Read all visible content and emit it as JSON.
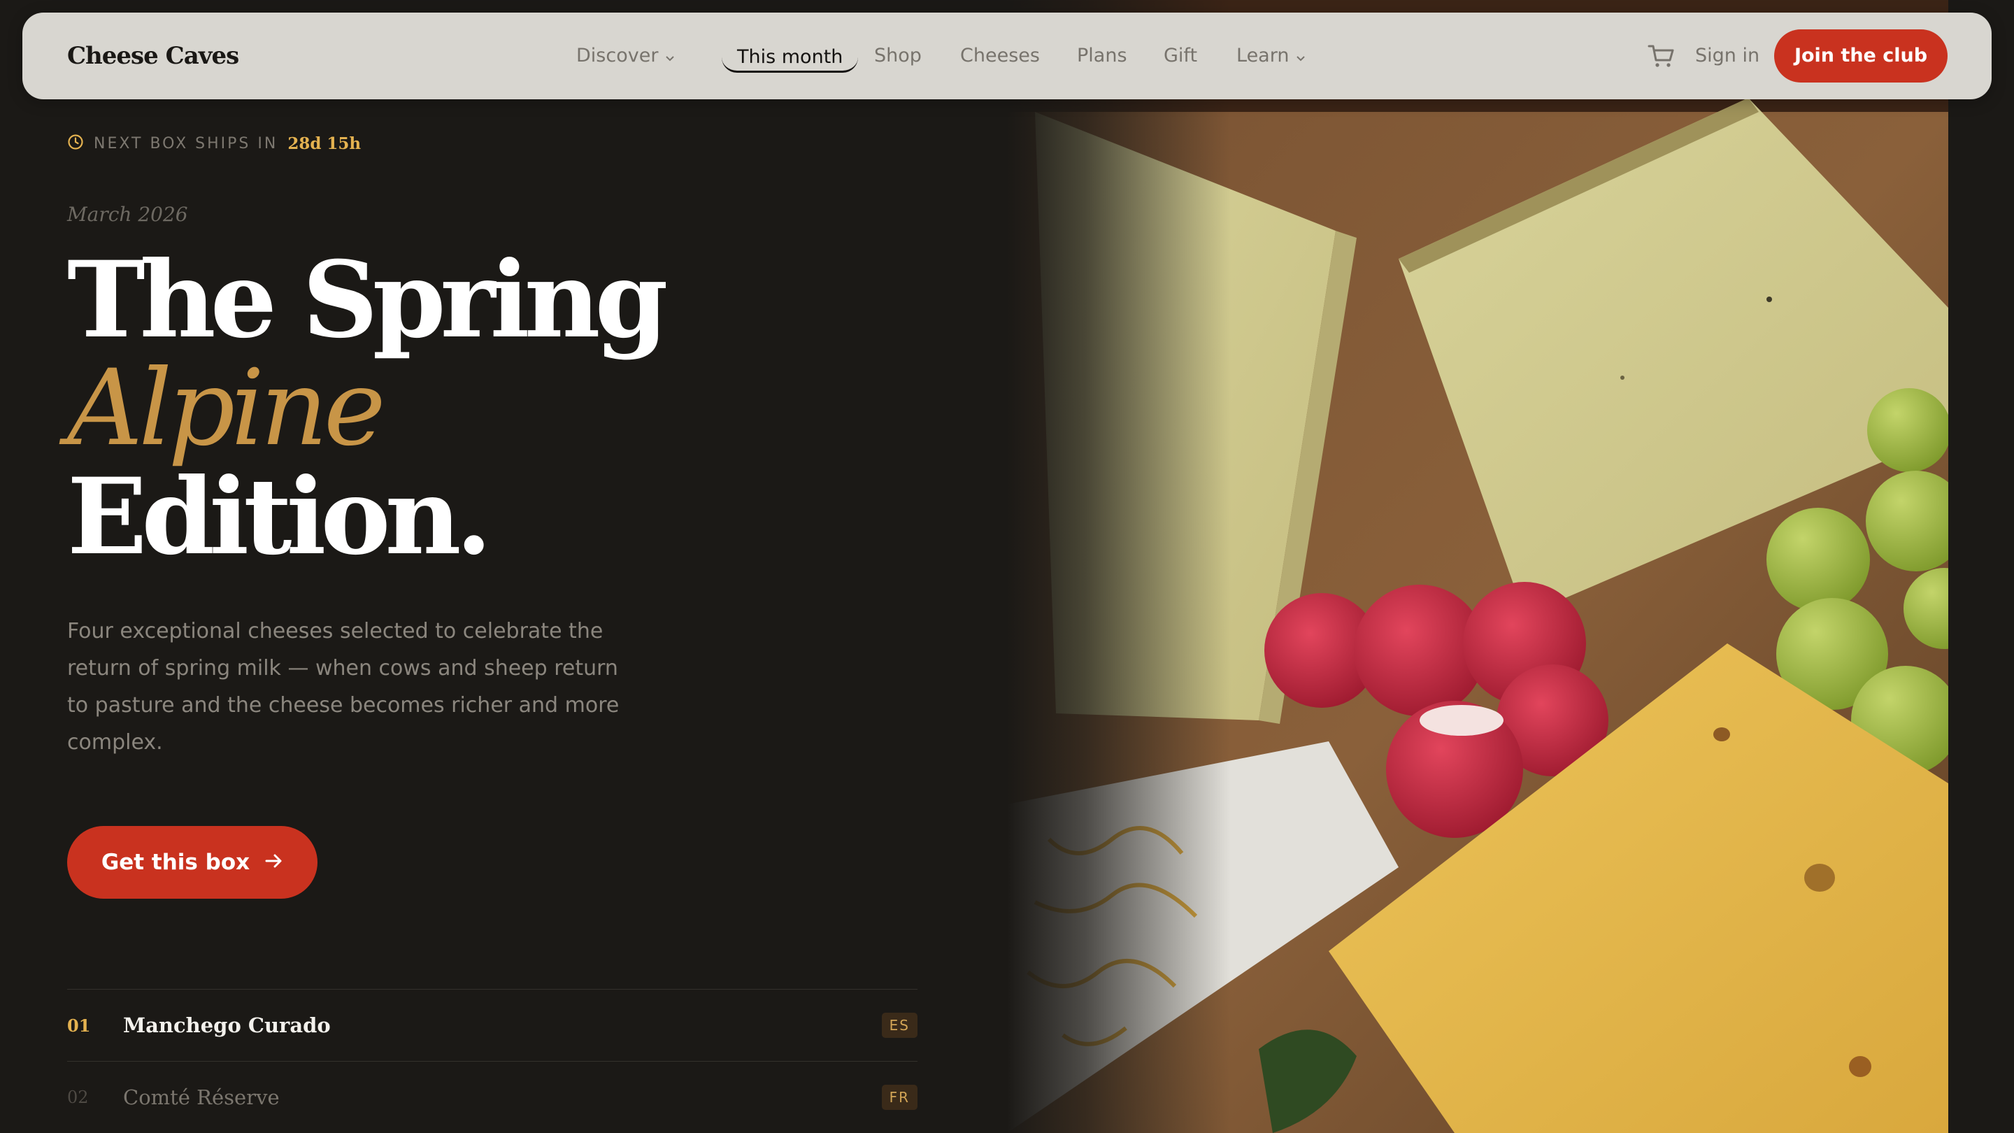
{
  "nav": {
    "brand": "Cheese Caves",
    "links": [
      {
        "label": "Discover",
        "dropdown": true
      },
      {
        "label": "This month",
        "active": true
      },
      {
        "label": "Shop"
      },
      {
        "label": "Cheeses"
      },
      {
        "label": "Plans"
      },
      {
        "label": "Gift"
      },
      {
        "label": "Learn",
        "dropdown": true
      }
    ],
    "cart_icon": "cart-icon",
    "signin": "Sign in",
    "join": "Join the club"
  },
  "ships": {
    "icon": "clock-icon",
    "label": "NEXT BOX SHIPS IN",
    "value": "28d 15h"
  },
  "hero": {
    "date": "March 2026",
    "headline": {
      "line1": "The Spring",
      "line2": "Alpine",
      "line3": "Edition."
    },
    "description": "Four exceptional cheeses selected to celebrate the return of spring milk — when cows and sheep return to pasture and the cheese becomes richer and more complex.",
    "cta_label": "Get this box",
    "cta_icon": "arrow-right-icon"
  },
  "cheeses": [
    {
      "num": "01",
      "name": "Manchego Curado",
      "country": "ES",
      "active": true
    },
    {
      "num": "02",
      "name": "Comté Réserve",
      "country": "FR",
      "active": false
    }
  ],
  "colors": {
    "background": "#1b1916",
    "accent_red": "#c9321f",
    "accent_gold": "#e4b250",
    "headline_accent": "#c89547",
    "nav_bg": "#d8d6d0"
  }
}
